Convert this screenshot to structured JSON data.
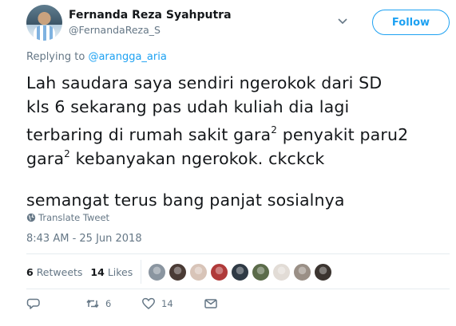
{
  "author": {
    "name": "Fernanda Reza Syahputra",
    "handle": "@FernandaReza_S"
  },
  "follow_label": "Follow",
  "reply_context": {
    "prefix": "Replying to",
    "mention": "@arangga_aria"
  },
  "tweet": {
    "line1": "Lah saudara saya sendiri ngerokok dari SD",
    "line2": "kls 6 sekarang pas udah kuliah dia lagi",
    "line3_a": "terbaring di rumah sakit gara",
    "line3_sup": "2",
    "line3_b": " penyakit paru2",
    "line4_a": "gara",
    "line4_sup": "2",
    "line4_b": " kebanyakan ngerokok. ckckck",
    "line5": "semangat terus bang panjat sosialnya"
  },
  "translate_label": "Translate Tweet",
  "timestamp": "8:43 AM - 25 Jun 2018",
  "stats": {
    "retweets_count": "6",
    "retweets_label": "Retweets",
    "likes_count": "14",
    "likes_label": "Likes"
  },
  "liker_avatar_colors": [
    "#8a95a0",
    "#4a3b35",
    "#d8c4b8",
    "#b03a3a",
    "#2f3a45",
    "#5b6b4a",
    "#e2dcd6",
    "#9a8f86",
    "#3b3430"
  ],
  "actions": {
    "reply_count": "",
    "retweet_count": "6",
    "like_count": "14"
  },
  "colors": {
    "accent": "#1da1f2",
    "muted": "#657786",
    "text": "#14171a"
  }
}
